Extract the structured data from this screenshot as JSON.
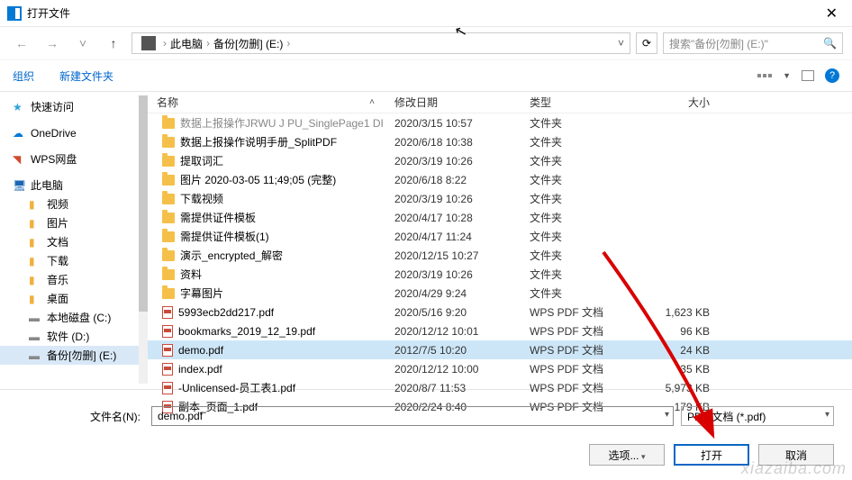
{
  "title": "打开文件",
  "breadcrumb": {
    "pc": "此电脑",
    "drive": "备份[勿删] (E:)"
  },
  "search_placeholder": "搜索\"备份[勿删] (E:)\"",
  "toolbar": {
    "organize": "组织",
    "new_folder": "新建文件夹"
  },
  "columns": {
    "name": "名称",
    "date": "修改日期",
    "type": "类型",
    "size": "大小"
  },
  "sidebar": {
    "quick": "快速访问",
    "onedrive": "OneDrive",
    "wps": "WPS网盘",
    "pc": "此电脑",
    "video": "视频",
    "pictures": "图片",
    "documents": "文档",
    "downloads": "下载",
    "music": "音乐",
    "desktop": "桌面",
    "disk_c": "本地磁盘 (C:)",
    "disk_d": "软件 (D:)",
    "disk_e": "备份[勿删] (E:)"
  },
  "files": [
    {
      "kind": "folder",
      "name": "数据上报操作JRWU J PU_SinglePage1 DI",
      "date": "2020/3/15 10:57",
      "type": "文件夹",
      "size": "",
      "partial": true
    },
    {
      "kind": "folder",
      "name": "数据上报操作说明手册_SplitPDF",
      "date": "2020/6/18 10:38",
      "type": "文件夹",
      "size": ""
    },
    {
      "kind": "folder",
      "name": "提取词汇",
      "date": "2020/3/19 10:26",
      "type": "文件夹",
      "size": ""
    },
    {
      "kind": "folder",
      "name": "图片 2020-03-05 11;49;05 (完整)",
      "date": "2020/6/18 8:22",
      "type": "文件夹",
      "size": ""
    },
    {
      "kind": "folder",
      "name": "下载视频",
      "date": "2020/3/19 10:26",
      "type": "文件夹",
      "size": ""
    },
    {
      "kind": "folder",
      "name": "需提供证件模板",
      "date": "2020/4/17 10:28",
      "type": "文件夹",
      "size": ""
    },
    {
      "kind": "folder",
      "name": "需提供证件模板(1)",
      "date": "2020/4/17 11:24",
      "type": "文件夹",
      "size": ""
    },
    {
      "kind": "folder",
      "name": "演示_encrypted_解密",
      "date": "2020/12/15 10:27",
      "type": "文件夹",
      "size": ""
    },
    {
      "kind": "folder",
      "name": "资料",
      "date": "2020/3/19 10:26",
      "type": "文件夹",
      "size": ""
    },
    {
      "kind": "folder",
      "name": "字幕图片",
      "date": "2020/4/29 9:24",
      "type": "文件夹",
      "size": ""
    },
    {
      "kind": "pdf",
      "name": "5993ecb2dd217.pdf",
      "date": "2020/5/16 9:20",
      "type": "WPS PDF 文档",
      "size": "1,623 KB"
    },
    {
      "kind": "pdf",
      "name": "bookmarks_2019_12_19.pdf",
      "date": "2020/12/12 10:01",
      "type": "WPS PDF 文档",
      "size": "96 KB"
    },
    {
      "kind": "pdf",
      "name": "demo.pdf",
      "date": "2012/7/5 10:20",
      "type": "WPS PDF 文档",
      "size": "24 KB",
      "selected": true
    },
    {
      "kind": "pdf",
      "name": "index.pdf",
      "date": "2020/12/12 10:00",
      "type": "WPS PDF 文档",
      "size": "35 KB"
    },
    {
      "kind": "pdf",
      "name": "-Unlicensed-员工表1.pdf",
      "date": "2020/8/7 11:53",
      "type": "WPS PDF 文档",
      "size": "5,973 KB"
    },
    {
      "kind": "pdf",
      "name": "副本_页面_1.pdf",
      "date": "2020/2/24 8:40",
      "type": "WPS PDF 文档",
      "size": "179 KB"
    }
  ],
  "footer": {
    "filename_label": "文件名(N):",
    "filename_value": "demo.pdf",
    "filter": "PDF 文档 (*.pdf)",
    "tools": "选项...",
    "open": "打开",
    "cancel": "取消"
  },
  "watermark": "xiazaiba.com"
}
